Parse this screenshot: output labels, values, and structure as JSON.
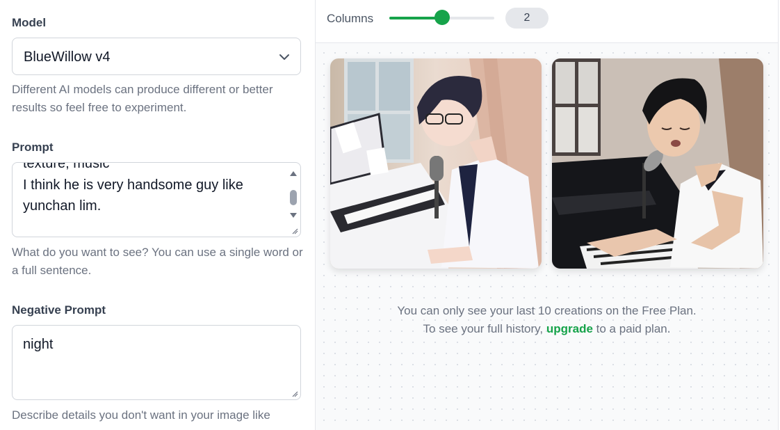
{
  "model": {
    "label": "Model",
    "selected": "BlueWillow v4",
    "help": "Different AI models can produce different or better results so feel free to experiment."
  },
  "prompt": {
    "label": "Prompt",
    "clipped_line": "texture, music",
    "value": "I think he is very handsome guy like yunchan lim.",
    "help": "What do you want to see? You can use a single word or a full sentence."
  },
  "negative_prompt": {
    "label": "Negative Prompt",
    "value": "night",
    "help": "Describe details you don't want in your image like"
  },
  "gallery": {
    "columns_label": "Columns",
    "columns_value": "2",
    "columns_fraction": 0.5,
    "images": [
      {
        "name": "anime-pianist-image"
      },
      {
        "name": "realistic-pianist-image"
      }
    ],
    "notice_line1": "You can only see your last 10 creations on the Free Plan.",
    "notice_pre": "To see your full history,",
    "upgrade_link": "upgrade",
    "notice_post": "to a paid plan."
  },
  "colors": {
    "accent": "#16a34a",
    "border": "#d1d5db",
    "muted_text": "#6b7280"
  }
}
